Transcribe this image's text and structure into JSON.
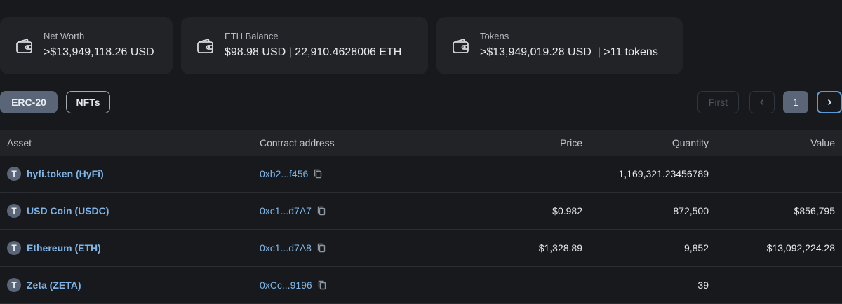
{
  "summary": {
    "net_worth": {
      "label": "Net Worth",
      "value": ">$13,949,118.26 USD"
    },
    "eth_balance": {
      "label": "ETH Balance",
      "value": "$98.98 USD | 22,910.4628006 ETH"
    },
    "tokens": {
      "label": "Tokens",
      "value": ">$13,949,019.28 USD  | >11 tokens"
    }
  },
  "tabs": [
    {
      "label": "ERC-20",
      "active": true
    },
    {
      "label": "NFTs",
      "active": false
    }
  ],
  "pagination": {
    "first_label": "First",
    "current_page": "1"
  },
  "table": {
    "headers": {
      "asset": "Asset",
      "contract": "Contract address",
      "price": "Price",
      "quantity": "Quantity",
      "value": "Value"
    },
    "rows": [
      {
        "badge": "T",
        "asset": "hyfi.token (HyFi)",
        "contract": "0xb2...f456",
        "price": "",
        "quantity": "1,169,321.23456789",
        "value": ""
      },
      {
        "badge": "T",
        "asset": "USD Coin (USDC)",
        "contract": "0xc1...d7A7",
        "price": "$0.982",
        "quantity": "872,500",
        "value": "$856,795"
      },
      {
        "badge": "T",
        "asset": "Ethereum (ETH)",
        "contract": "0xc1...d7A8",
        "price": "$1,328.89",
        "quantity": "9,852",
        "value": "$13,092,224.28"
      },
      {
        "badge": "T",
        "asset": "Zeta (ZETA)",
        "contract": "0xCc...9196",
        "price": "",
        "quantity": "39",
        "value": ""
      }
    ]
  },
  "colors": {
    "background": "#17191c",
    "card": "#212327",
    "link": "#7fb5e8",
    "accent": "#5a6577"
  },
  "icons": {
    "card": "wallet-icon",
    "copy": "copy-icon",
    "prev": "chevron-left-icon",
    "next": "chevron-right-icon"
  }
}
